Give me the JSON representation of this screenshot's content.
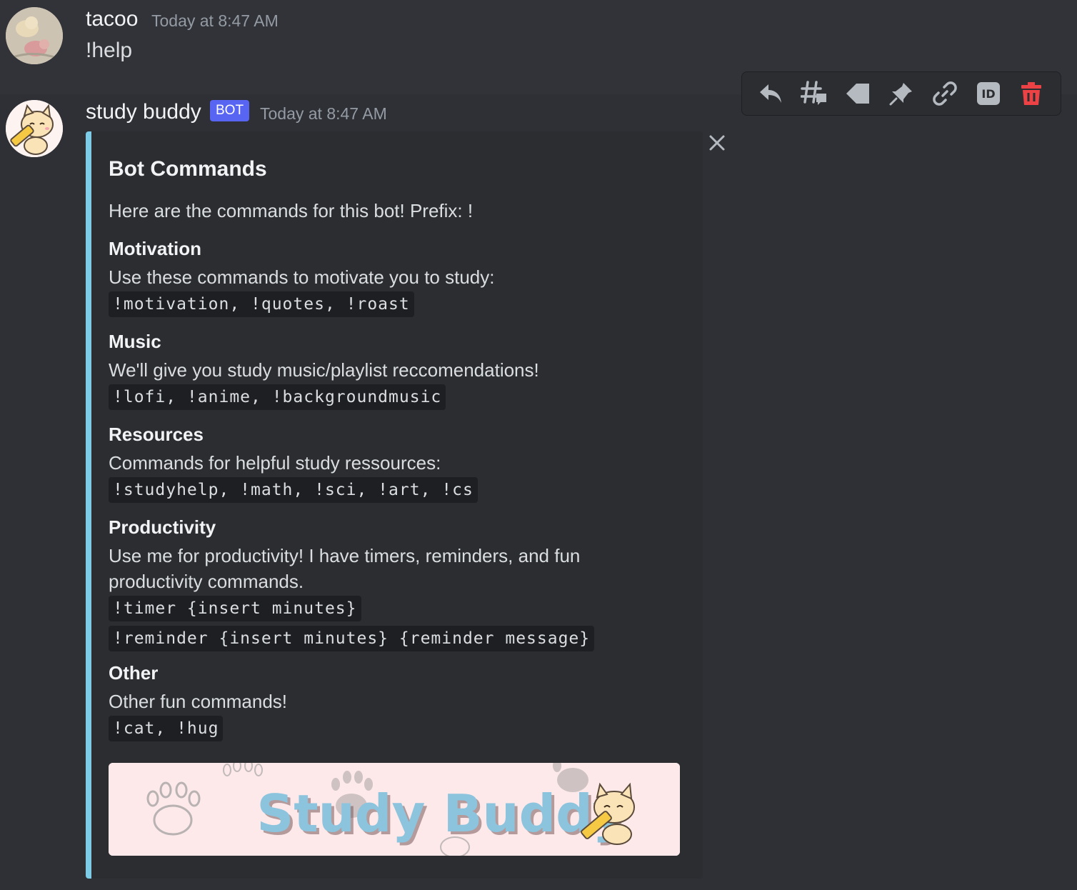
{
  "message1": {
    "username": "tacoo",
    "timestamp": "Today at 8:47 AM",
    "content": "!help"
  },
  "message2": {
    "username": "study buddy",
    "bot_tag": "BOT",
    "timestamp": "Today at 8:47 AM"
  },
  "toolbar": {
    "icons": [
      "reply-icon",
      "thread-icon",
      "tag-icon",
      "pin-icon",
      "link-icon",
      "id-icon",
      "delete-icon"
    ],
    "delete_color": "#ed4245"
  },
  "embed": {
    "accent_color": "#7ecbe8",
    "title": "Bot Commands",
    "description": "Here are the commands for this bot! Prefix: !",
    "fields": [
      {
        "name": "Motivation",
        "text": "Use these commands to motivate you to study:",
        "codes": [
          "!motivation, !quotes, !roast"
        ]
      },
      {
        "name": "Music",
        "text": "We'll give you study music/playlist reccomendations!",
        "codes": [
          "!lofi, !anime, !backgroundmusic"
        ]
      },
      {
        "name": "Resources",
        "text": "Commands for helpful study ressources:",
        "codes": [
          "!studyhelp, !math, !sci, !art, !cs"
        ]
      },
      {
        "name": "Productivity",
        "text": "Use me for productivity! I have timers, reminders, and fun productivity commands.",
        "codes": [
          "!timer {insert minutes}",
          "!reminder {insert minutes} {reminder message}"
        ]
      },
      {
        "name": "Other",
        "text": "Other fun commands!",
        "codes": [
          "!cat, !hug"
        ]
      }
    ],
    "banner_text": "Study Buddy"
  }
}
